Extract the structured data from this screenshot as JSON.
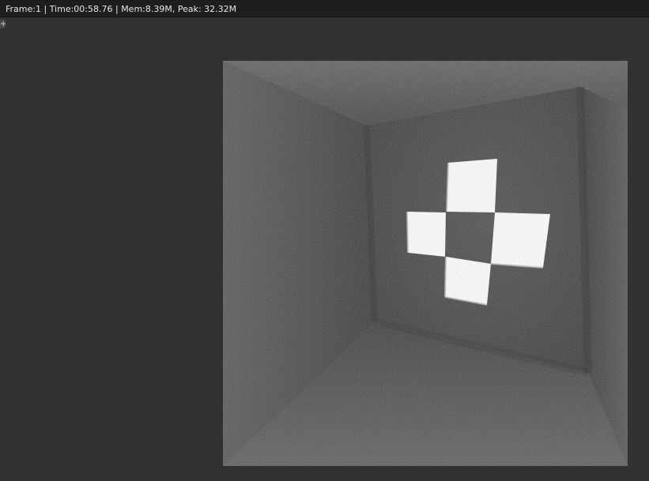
{
  "status_bar": {
    "text": "Frame:1 | Time:00:58.76 | Mem:8.39M, Peak: 32.32M"
  },
  "region_toggle": {
    "label": "+"
  },
  "render": {
    "wall_color": "#4a4a4a",
    "floor_color": "#595959",
    "ceiling_color": "#5d5d5d",
    "emitter_color": "#ffffff"
  }
}
